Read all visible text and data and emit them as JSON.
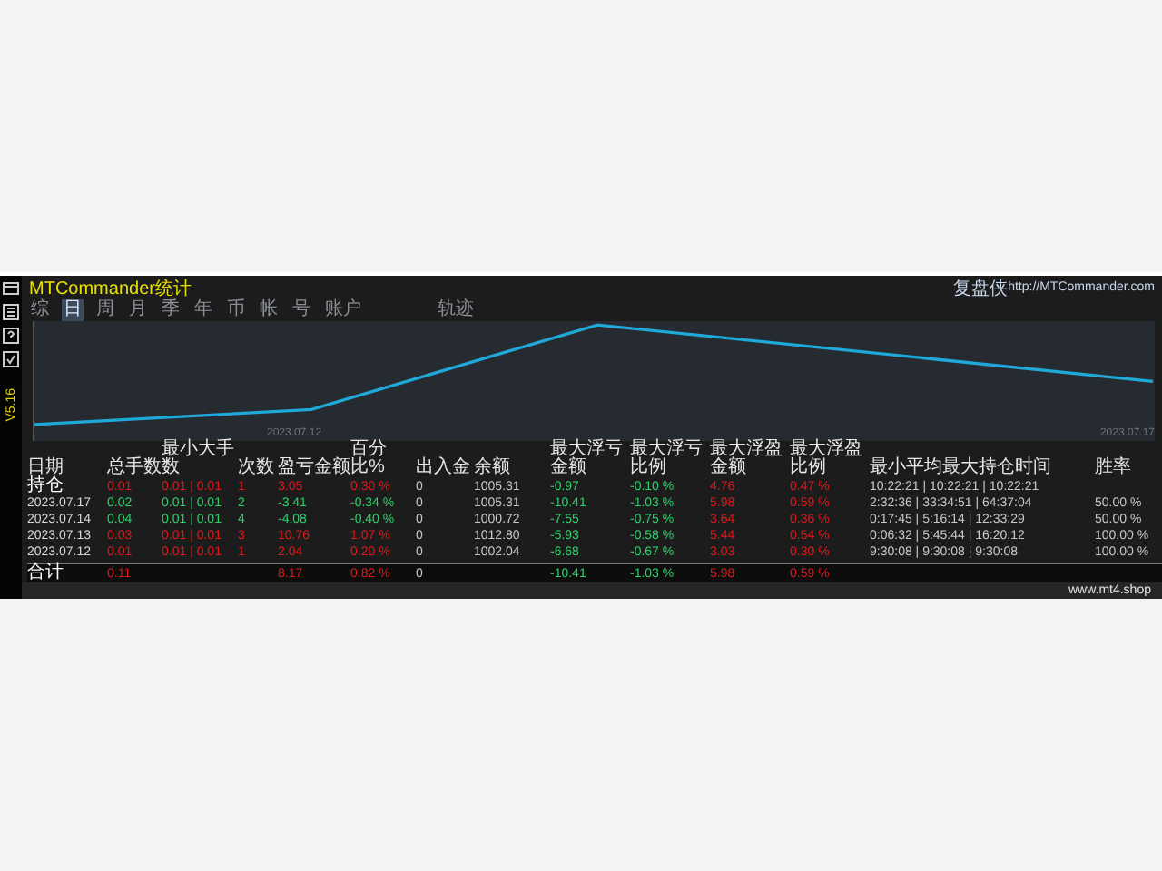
{
  "window": {
    "title": "MTCommander统计",
    "brand": "复盘侠",
    "url": "http://MTCommander.com"
  },
  "toolbar": {
    "version": "V5.16"
  },
  "tabs": [
    {
      "label": "综",
      "selected": false
    },
    {
      "label": "日",
      "selected": true
    },
    {
      "label": "周",
      "selected": false
    },
    {
      "label": "月",
      "selected": false
    },
    {
      "label": "季",
      "selected": false
    },
    {
      "label": "年",
      "selected": false
    },
    {
      "label": "币",
      "selected": false
    },
    {
      "label": "帐",
      "selected": false
    },
    {
      "label": "号",
      "selected": false
    },
    {
      "label": "账户",
      "selected": false
    },
    {
      "label": "轨迹",
      "selected": false
    }
  ],
  "chart": {
    "start_label": "2023.07.12",
    "end_label": "2023.07.17"
  },
  "table": {
    "columns": [
      {
        "label": "日期",
        "kind": "date"
      },
      {
        "label": "总手数",
        "kind": "signed"
      },
      {
        "label": "最小大手数",
        "kind": "signed"
      },
      {
        "label": "次数",
        "kind": "signed"
      },
      {
        "label": "盈亏金额",
        "kind": "signed"
      },
      {
        "label": "百分比%",
        "kind": "signed"
      },
      {
        "label": "出入金",
        "kind": "plain"
      },
      {
        "label": "余额",
        "kind": "plain"
      },
      {
        "label": "最大浮亏金额",
        "kind": "loss"
      },
      {
        "label": "最大浮亏比例",
        "kind": "loss"
      },
      {
        "label": "最大浮盈金额",
        "kind": "gain"
      },
      {
        "label": "最大浮盈比例",
        "kind": "gain"
      },
      {
        "label": "最小平均最大持仓时间",
        "kind": "plain"
      },
      {
        "label": "胜率",
        "kind": "plain"
      }
    ],
    "rows": [
      {
        "kind": "position",
        "gain": true,
        "cells": [
          "持仓",
          "0.01",
          "0.01 | 0.01",
          "1",
          "3.05",
          "0.30 %",
          "0",
          "1005.31",
          "-0.97",
          "-0.10 %",
          "4.76",
          "0.47 %",
          "10:22:21 | 10:22:21 | 10:22:21",
          ""
        ]
      },
      {
        "kind": "day",
        "gain": false,
        "cells": [
          "2023.07.17",
          "0.02",
          "0.01 | 0.01",
          "2",
          "-3.41",
          "-0.34 %",
          "0",
          "1005.31",
          "-10.41",
          "-1.03 %",
          "5.98",
          "0.59 %",
          "2:32:36 | 33:34:51 | 64:37:04",
          "50.00 %"
        ]
      },
      {
        "kind": "day",
        "gain": false,
        "cells": [
          "2023.07.14",
          "0.04",
          "0.01 | 0.01",
          "4",
          "-4.08",
          "-0.40 %",
          "0",
          "1000.72",
          "-7.55",
          "-0.75 %",
          "3.64",
          "0.36 %",
          "0:17:45 | 5:16:14 | 12:33:29",
          "50.00 %"
        ]
      },
      {
        "kind": "day",
        "gain": true,
        "cells": [
          "2023.07.13",
          "0.03",
          "0.01 | 0.01",
          "3",
          "10.76",
          "1.07 %",
          "0",
          "1012.80",
          "-5.93",
          "-0.58 %",
          "5.44",
          "0.54 %",
          "0:06:32 | 5:45:44 | 16:20:12",
          "100.00 %"
        ]
      },
      {
        "kind": "day",
        "gain": true,
        "cells": [
          "2023.07.12",
          "0.01",
          "0.01 | 0.01",
          "1",
          "2.04",
          "0.20 %",
          "0",
          "1002.04",
          "-6.68",
          "-0.67 %",
          "3.03",
          "0.30 %",
          "9:30:08 | 9:30:08 | 9:30:08",
          "100.00 %"
        ]
      },
      {
        "kind": "total",
        "gain": true,
        "cells": [
          "合计",
          "0.11",
          "",
          "",
          "8.17",
          "0.82 %",
          "0",
          "",
          "-10.41",
          "-1.03 %",
          "5.98",
          "0.59 %",
          "",
          ""
        ]
      }
    ]
  },
  "footer": {
    "site": "www.mt4.shop"
  }
}
